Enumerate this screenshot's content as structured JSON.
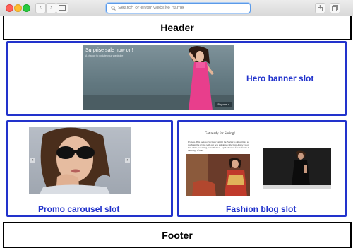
{
  "browser": {
    "url_placeholder": "Search or enter website name",
    "back_icon": "chevron-left-icon",
    "forward_icon": "chevron-right-icon"
  },
  "header": {
    "label": "Header"
  },
  "hero": {
    "slot_label": "Hero banner slot",
    "banner_title": "Surprise sale now on!",
    "banner_subtitle": "A chance to update your wardrobe",
    "banner_cta": "Buy now ›"
  },
  "promo": {
    "slot_label": "Promo carousel slot"
  },
  "blog": {
    "slot_label": "Fashion blog slot",
    "article_title": "Get ready for Spring!",
    "article_body": "It's here. This look you've been waiting for, Spring is almost here so ready and be stylish with our new signature collection. A new color best while presenting yourself down. April observes for the future in our range of hats."
  },
  "footer": {
    "label": "Footer"
  },
  "colors": {
    "slot_border": "#2233cc",
    "slot_label": "#2233cc",
    "hero_dress": "#e83e8c"
  }
}
